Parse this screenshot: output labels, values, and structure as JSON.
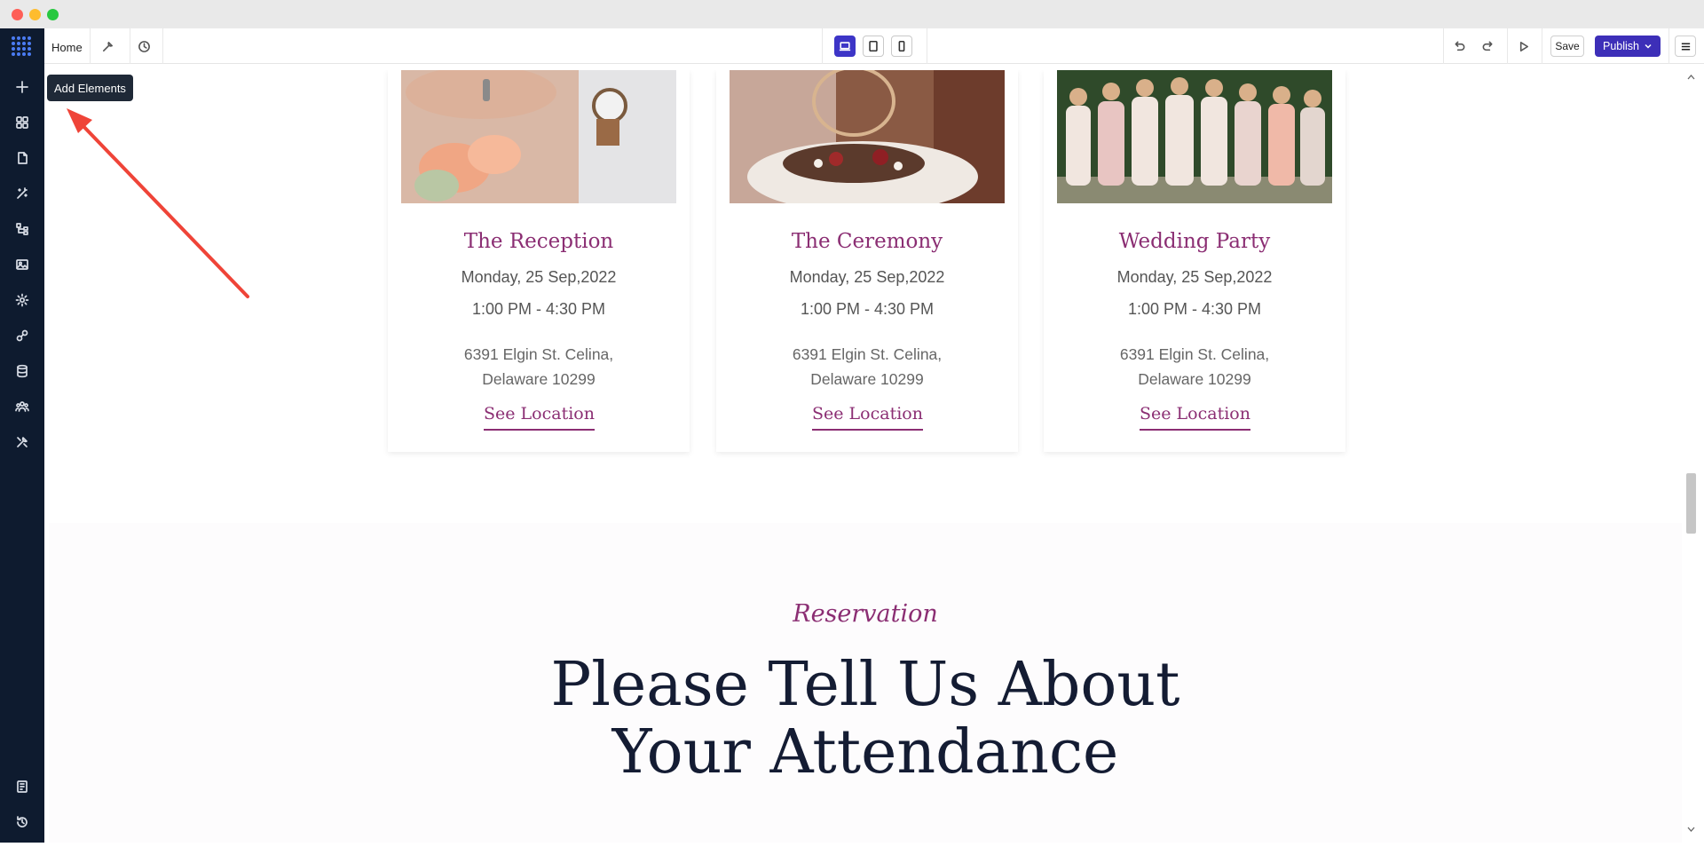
{
  "window": {
    "traffic_lights": {
      "close": "#fe5f57",
      "minimize": "#febc2e",
      "maximize": "#28c840"
    }
  },
  "toolbar": {
    "home_label": "Home",
    "save_label": "Save",
    "publish_label": "Publish",
    "accent_color": "#3d2fb8",
    "devices": [
      "desktop-icon",
      "tablet-icon",
      "mobile-icon"
    ],
    "active_device": "desktop"
  },
  "sidebar": {
    "items": [
      {
        "icon": "plus-icon"
      },
      {
        "icon": "grid-icon"
      },
      {
        "icon": "page-icon"
      },
      {
        "icon": "magic-wand-icon"
      },
      {
        "icon": "sitemap-icon"
      },
      {
        "icon": "image-icon"
      },
      {
        "icon": "settings-icon"
      },
      {
        "icon": "integration-icon"
      },
      {
        "icon": "database-icon"
      },
      {
        "icon": "users-icon"
      },
      {
        "icon": "tools-icon"
      }
    ],
    "bottom_items": [
      {
        "icon": "book-icon"
      },
      {
        "icon": "history-icon"
      }
    ]
  },
  "tooltip": {
    "label": "Add Elements"
  },
  "events": [
    {
      "title": "The Reception",
      "date": "Monday, 25 Sep,2022",
      "time": "1:00 PM - 4:30 PM",
      "address_line1": "6391 Elgin St. Celina,",
      "address_line2": "Delaware 10299",
      "link": "See Location"
    },
    {
      "title": "The Ceremony",
      "date": "Monday, 25 Sep,2022",
      "time": "1:00 PM - 4:30 PM",
      "address_line1": "6391 Elgin St. Celina,",
      "address_line2": "Delaware 10299",
      "link": "See Location"
    },
    {
      "title": "Wedding Party",
      "date": "Monday, 25 Sep,2022",
      "time": "1:00 PM - 4:30 PM",
      "address_line1": "6391 Elgin St. Celina,",
      "address_line2": "Delaware 10299",
      "link": "See Location"
    }
  ],
  "reservation": {
    "kicker": "Reservation",
    "heading_line1": "Please Tell Us About",
    "heading_line2": "Your Attendance"
  },
  "colors": {
    "brand": "#8b2e73",
    "heading": "#141c33",
    "sidebar": "#0e1b2f",
    "annotation_arrow": "#ef4438"
  }
}
